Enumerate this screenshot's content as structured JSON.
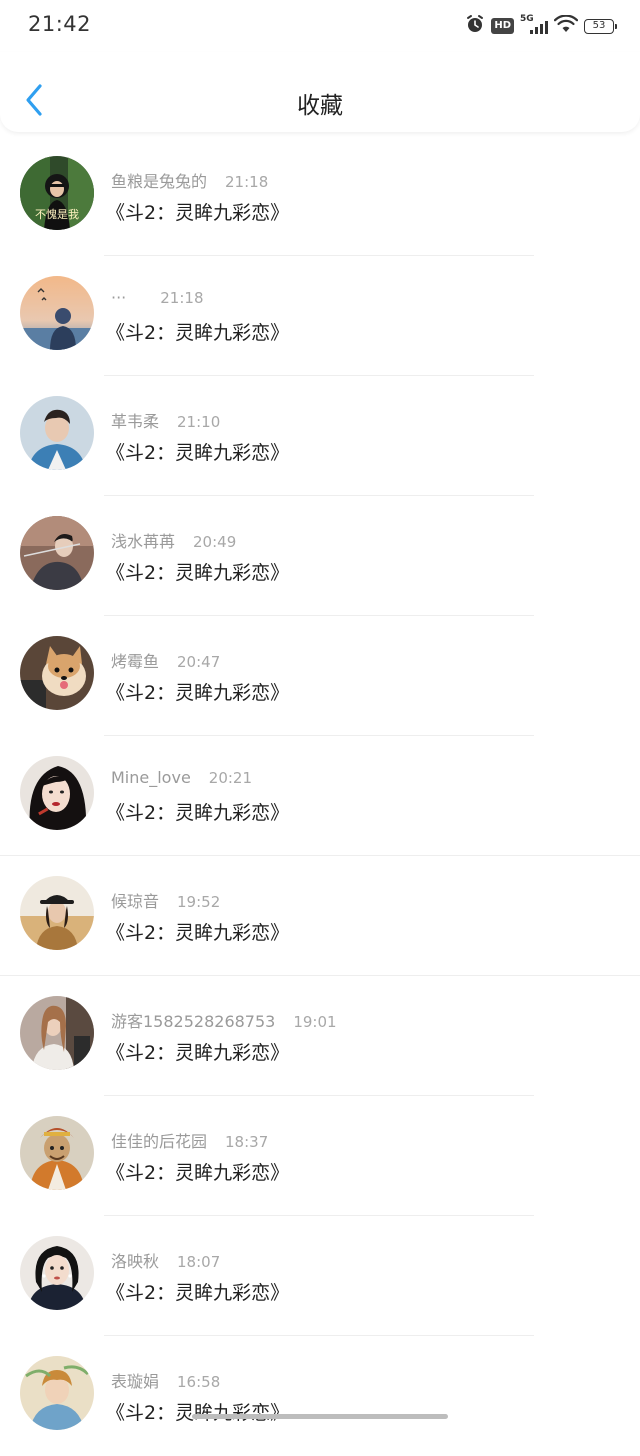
{
  "status_bar": {
    "time": "21:42",
    "network": "5G",
    "hd_label": "HD",
    "battery": "53",
    "icons": [
      "alarm-icon",
      "hd-icon",
      "signal-icon",
      "wifi-icon",
      "battery-icon"
    ]
  },
  "header": {
    "title": "收藏",
    "back_icon": "chevron-left-icon",
    "accent_color": "#2f9ff0"
  },
  "items": [
    {
      "name": "鱼粮是兔兔的",
      "time": "21:18",
      "content": "《斗2：灵眸九彩恋》",
      "avatar_text": "不愧是我"
    },
    {
      "name": "···",
      "time": "21:18",
      "content": "《斗2：灵眸九彩恋》"
    },
    {
      "name": "革韦柔",
      "time": "21:10",
      "content": "《斗2：灵眸九彩恋》"
    },
    {
      "name": "浅水苒苒",
      "time": "20:49",
      "content": "《斗2：灵眸九彩恋》"
    },
    {
      "name": "烤霉鱼",
      "time": "20:47",
      "content": "《斗2：灵眸九彩恋》"
    },
    {
      "name": "Mine_love",
      "time": "20:21",
      "content": "《斗2：灵眸九彩恋》"
    },
    {
      "name": "候琼音",
      "time": "19:52",
      "content": "《斗2：灵眸九彩恋》"
    },
    {
      "name": "游客1582528268753",
      "time": "19:01",
      "content": "《斗2：灵眸九彩恋》"
    },
    {
      "name": "佳佳的后花园",
      "time": "18:37",
      "content": "《斗2：灵眸九彩恋》"
    },
    {
      "name": "洛映秋",
      "time": "18:07",
      "content": "《斗2：灵眸九彩恋》"
    },
    {
      "name": "表璇娟",
      "time": "16:58",
      "content": "《斗2：灵眸九彩恋》"
    }
  ]
}
